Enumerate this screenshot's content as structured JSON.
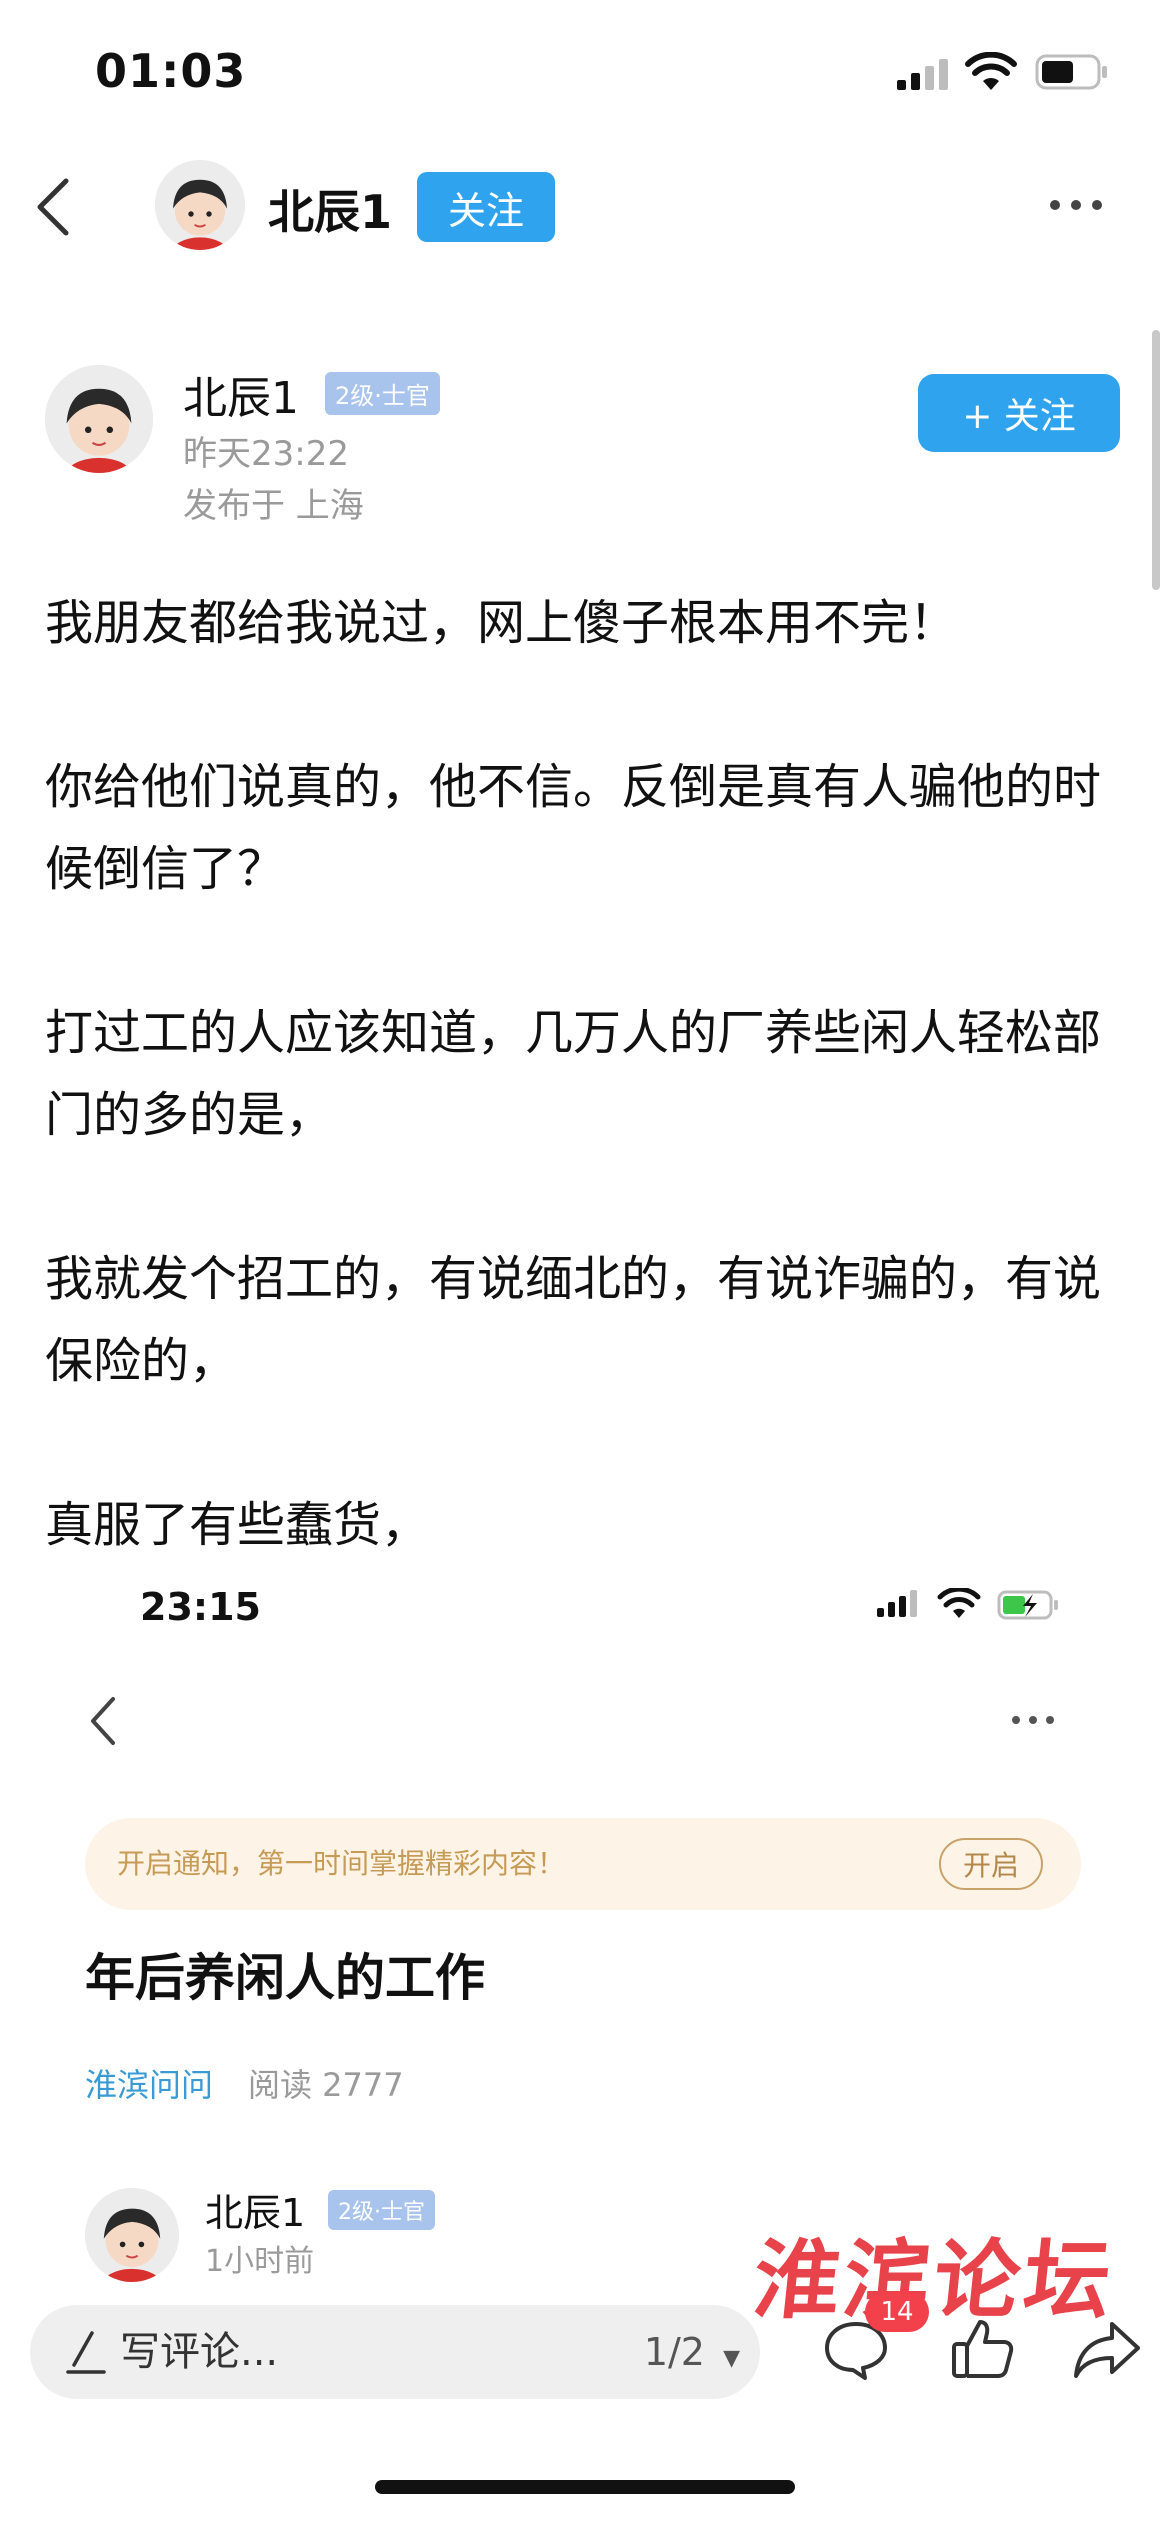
{
  "status_bar": {
    "time": "01:03",
    "battery_level": 0.55
  },
  "nav": {
    "username": "北辰1",
    "follow_label": "关注"
  },
  "author": {
    "name": "北辰1",
    "level": "2级·士官",
    "time": "昨天23:22",
    "location": "发布于 上海",
    "follow_label": "+ 关注"
  },
  "post": {
    "paragraphs": [
      "我朋友都给我说过，网上傻子根本用不完！",
      "你给他们说真的，他不信。反倒是真有人骗他的时候倒信了？",
      "打过工的人应该知道，几万人的厂养些闲人轻松部门的多的是，",
      "我就发个招工的，有说缅北的，有说诈骗的，有说保险的，",
      "真服了有些蠢货，"
    ]
  },
  "embedded_screenshot": {
    "time": "23:15",
    "notification_text": "开启通知，第一时间掌握精彩内容！",
    "notification_button": "开启",
    "title": "年后养闲人的工作",
    "board": "淮滨问问",
    "reads": "阅读 2777",
    "author_name": "北辰1",
    "author_level": "2级·士官",
    "author_time": "1小时前"
  },
  "bottom_bar": {
    "comment_placeholder": "写评论...",
    "page_indicator": "1/2",
    "comment_count": "14"
  },
  "watermark": "淮滨论坛",
  "colors": {
    "accent": "#2fa3ee",
    "badge_red": "#f2414a",
    "watermark": "#e8434b"
  }
}
